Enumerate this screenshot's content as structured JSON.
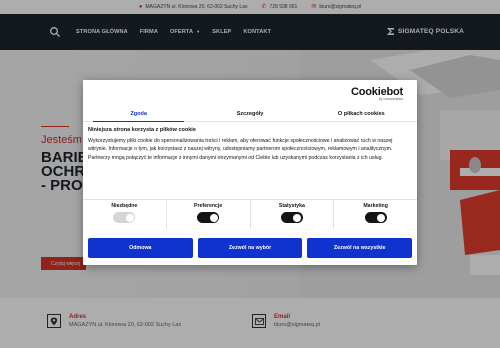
{
  "topbar": {
    "address": "MAGAZYN ul. Klonowa 20, 62-002 Suchy Las",
    "phone": "728 938 061",
    "email": "biuro@sigmateq.pl"
  },
  "nav": {
    "items": [
      {
        "label": "STRONA GŁÓWNA"
      },
      {
        "label": "FIRMA"
      },
      {
        "label": "OFERTA"
      },
      {
        "label": "SKLEP"
      },
      {
        "label": "KONTAKT"
      }
    ],
    "logo_text": "SIGMATEQ POLSKA"
  },
  "hero": {
    "subtitle": "Jesteśm",
    "title": "BARIE\nOCHR\n- PRO",
    "button_label": "Czytaj więcej"
  },
  "contacts": [
    {
      "heading": "Adres",
      "value": "MAGAZYN ul. Klonowa 20, 62-002 Suchy Las"
    },
    {
      "heading": "Email",
      "value": "biuro@sigmateq.pl"
    }
  ],
  "cookie_dialog": {
    "brand": "Cookiebot",
    "brand_by": "by Usercentrics",
    "tabs": [
      {
        "label": "Zgoda",
        "active": true
      },
      {
        "label": "Szczegóły",
        "active": false
      },
      {
        "label": "O plikach cookies",
        "active": false
      }
    ],
    "heading": "Niniejsza strona korzysta z plików cookie",
    "body": "Wykorzystujemy pliki cookie do spersonalizowania treści i reklam, aby oferować funkcje społecznościowe i analizować ruch w naszej witrynie. Informacje o tym, jak korzystasz z naszej witryny, udostępniamy partnerom społecznościowym, reklamowym i analitycznym. Partnerzy mogą połączyć te informacje z innymi danymi otrzymanymi od Ciebie lub uzyskanymi podczas korzystania z ich usług.",
    "toggles": [
      {
        "label": "Niezbędne",
        "on": true,
        "disabled": true
      },
      {
        "label": "Preferencje",
        "on": true
      },
      {
        "label": "Statystyka",
        "on": true
      },
      {
        "label": "Marketing",
        "on": true
      }
    ],
    "buttons": {
      "deny": "Odmowa",
      "allow_selection": "Zezwól na wybór",
      "allow_all": "Zezwól na wszystkie"
    }
  },
  "colors": {
    "accent_red": "#d6332a",
    "nav_bg": "#1c252d",
    "cookiebot_blue": "#1032cf"
  }
}
